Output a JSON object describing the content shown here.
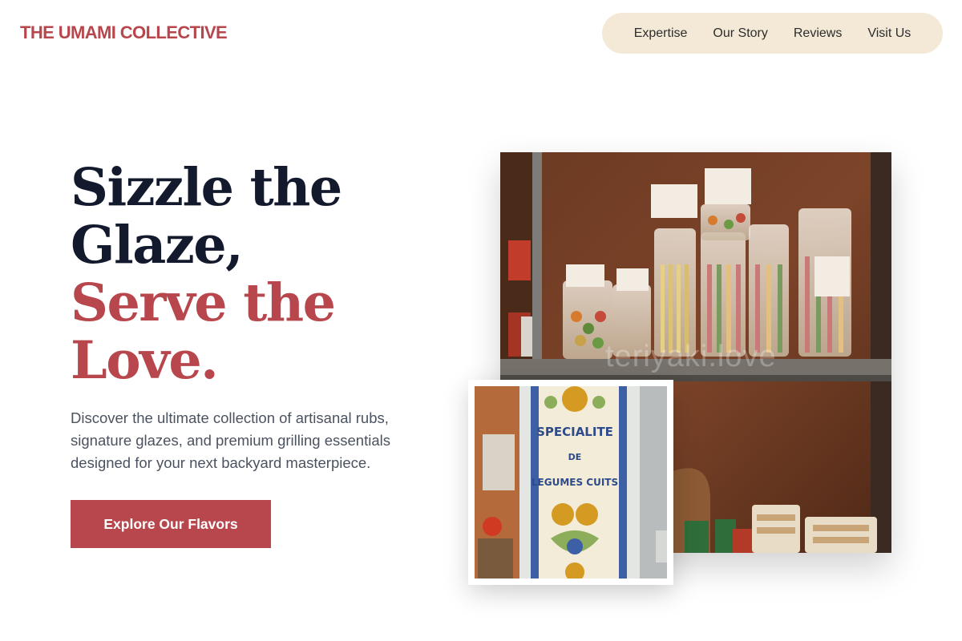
{
  "brand": {
    "name": "THE UMAMI COLLECTIVE"
  },
  "nav": {
    "items": [
      {
        "label": "Expertise"
      },
      {
        "label": "Our Story"
      },
      {
        "label": "Reviews"
      },
      {
        "label": "Visit Us"
      }
    ]
  },
  "hero": {
    "title_line_1": "Sizzle the",
    "title_line_2": "Glaze,",
    "title_line_3": "Serve the",
    "title_line_4": "Love.",
    "description": "Discover the ultimate collection of artisanal rubs, signature glazes, and premium grilling essentials designed for your next backyard masterpiece.",
    "cta_label": "Explore Our Flavors"
  },
  "images": {
    "main_watermark": "teriyaki.love",
    "sign_line_1": "SPECIALITE",
    "sign_line_2": "DE",
    "sign_line_3": "LEGUMES CUITS"
  },
  "colors": {
    "accent": "#b8474d",
    "heading_dark": "#141a2e",
    "nav_background": "#f3e9d6",
    "body_text": "#4b5260"
  }
}
